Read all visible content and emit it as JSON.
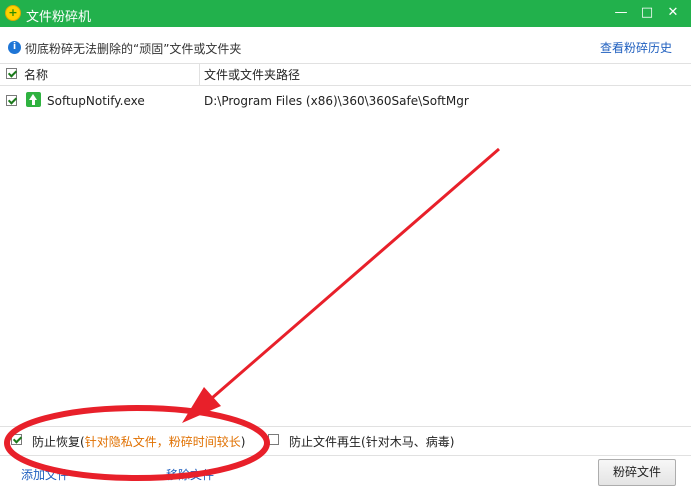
{
  "window": {
    "title": "文件粉碎机",
    "minimize": "—",
    "maximize": "□",
    "close": "✕"
  },
  "info": {
    "text": "彻底粉碎无法删除的“顽固”文件或文件夹",
    "history_link": "查看粉碎历史"
  },
  "table": {
    "columns": [
      "名称",
      "文件或文件夹路径"
    ],
    "rows": [
      {
        "name": "SoftupNotify.exe",
        "path": "D:\\Program Files (x86)\\360\\360Safe\\SoftMgr",
        "checked": true
      }
    ]
  },
  "options": {
    "prevent_recovery": "防止恢复",
    "prevent_recovery_hint": "针对隐私文件，粉碎时间较长",
    "prevent_regen": "防止文件再生",
    "prevent_regen_hint": "针对木马、病毒"
  },
  "footer": {
    "add_file": "添加文件",
    "remove_file": "移除文件",
    "shred_button": "粉碎文件"
  },
  "colors": {
    "titlebar": "#22b14c",
    "link": "#1f5fbf",
    "hint": "#e07000",
    "annotation": "#e8202a"
  }
}
